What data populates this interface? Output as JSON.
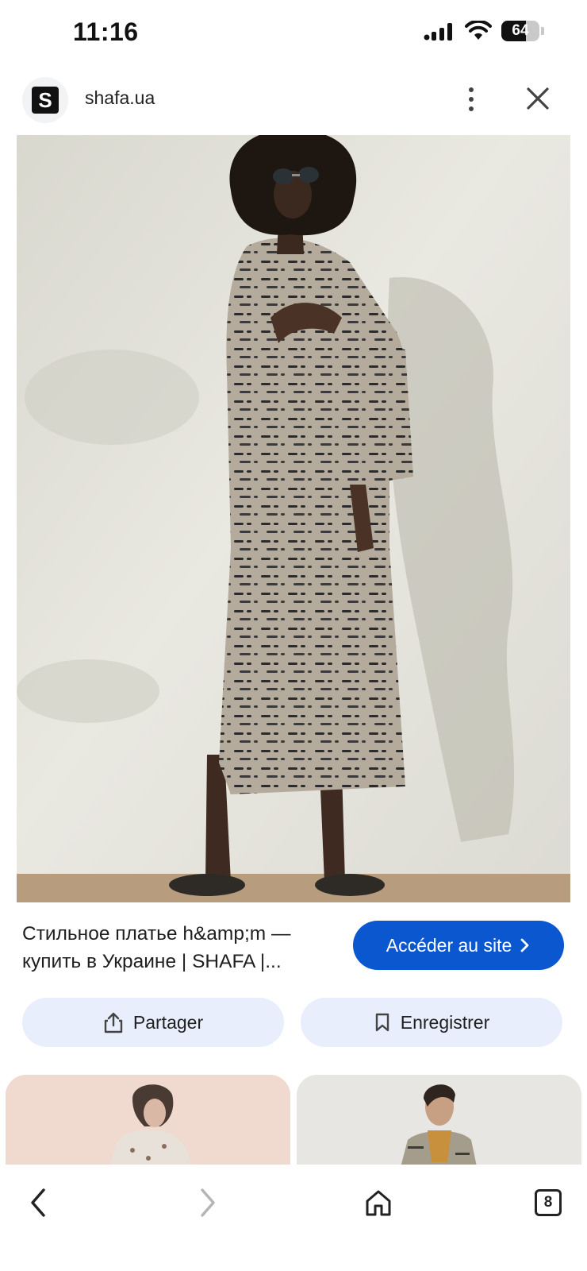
{
  "status_bar": {
    "time": "11:16",
    "battery_percent": "64",
    "battery_level": 0.64,
    "icons": [
      "signal-icon",
      "wifi-icon",
      "battery-icon"
    ]
  },
  "header": {
    "site_logo_letter": "S",
    "site_name": "shafa.ua",
    "icons": [
      "more-vert-icon",
      "close-icon"
    ]
  },
  "result": {
    "title": "Стильное платье h&amp;m — купить в Украине | SHAFA |...",
    "cta_label": "Accéder au site",
    "cta_icon": "chevron-right-icon"
  },
  "actions": {
    "share_label": "Partager",
    "share_icon": "share-icon",
    "save_label": "Enregistrer",
    "save_icon": "bookmark-icon"
  },
  "bottom_nav": {
    "icons": [
      "back-icon",
      "forward-icon",
      "home-icon",
      "tabs-icon"
    ],
    "tab_count": "8"
  },
  "colors": {
    "accent": "#0b57d0",
    "pill_background": "#e8eefb",
    "photo_wall": "#e4e3dc"
  }
}
